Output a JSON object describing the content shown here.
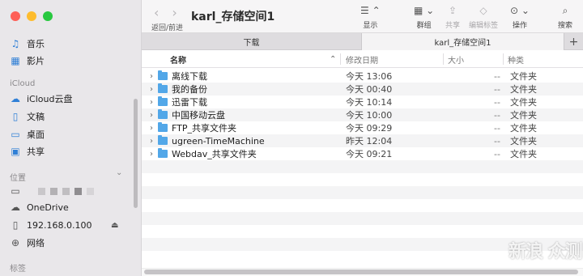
{
  "window": {
    "title": "karl_存储空间1",
    "nav_label": "返回/前进",
    "traffic": {
      "close": "#fe5f57",
      "minimize": "#febc2e",
      "maximize": "#28c840"
    }
  },
  "toolbar": {
    "view_label": "显示",
    "group_label": "群组",
    "share_label": "共享",
    "tag_label": "编辑标签",
    "action_label": "操作",
    "search_label": "搜索"
  },
  "tabs": [
    {
      "label": "下载"
    },
    {
      "label": "karl_存储空间1",
      "active": true
    }
  ],
  "sidebar": {
    "items_top": [
      {
        "label": "音乐",
        "icon": "music-icon"
      },
      {
        "label": "影片",
        "icon": "film-icon"
      }
    ],
    "icloud_heading": "iCloud",
    "icloud_items": [
      {
        "label": "iCloud云盘",
        "icon": "cloud-icon"
      },
      {
        "label": "文稿",
        "icon": "document-icon"
      },
      {
        "label": "桌面",
        "icon": "desktop-icon"
      },
      {
        "label": "共享",
        "icon": "shared-folder-icon"
      }
    ],
    "location_heading": "位置",
    "locations": [
      {
        "label": "",
        "icon": "computer-icon"
      },
      {
        "label": "OneDrive",
        "icon": "cloud-icon"
      },
      {
        "label": "192.168.0.100",
        "icon": "server-icon"
      },
      {
        "label": "网络",
        "icon": "globe-icon"
      }
    ],
    "tags_heading": "标签"
  },
  "columns": {
    "name": "名称",
    "date": "修改日期",
    "size": "大小",
    "kind": "种类"
  },
  "files": [
    {
      "name": "离线下载",
      "date": "今天 13:06",
      "size": "--",
      "kind": "文件夹"
    },
    {
      "name": "我的备份",
      "date": "今天 00:40",
      "size": "--",
      "kind": "文件夹"
    },
    {
      "name": "迅雷下载",
      "date": "今天 10:14",
      "size": "--",
      "kind": "文件夹"
    },
    {
      "name": "中国移动云盘",
      "date": "今天 10:00",
      "size": "--",
      "kind": "文件夹"
    },
    {
      "name": "FTP_共享文件夹",
      "date": "今天 09:29",
      "size": "--",
      "kind": "文件夹"
    },
    {
      "name": "ugreen-TimeMachine",
      "date": "昨天 12:04",
      "size": "--",
      "kind": "文件夹"
    },
    {
      "name": "Webdav_共享文件夹",
      "date": "今天 09:21",
      "size": "--",
      "kind": "文件夹"
    }
  ],
  "watermark": "新浪 众测"
}
